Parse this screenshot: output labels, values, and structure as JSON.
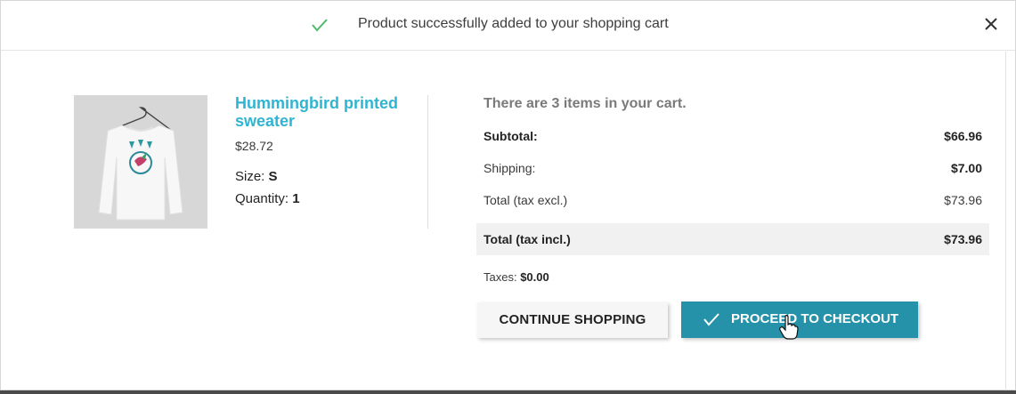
{
  "header": {
    "message": "Product successfully added to your shopping cart",
    "check_icon": "check-icon",
    "close_icon": "close-icon"
  },
  "product": {
    "image_icon": "sweater-image",
    "name": "Hummingbird printed sweater",
    "price": "$28.72",
    "size_label": "Size:",
    "size_value": "S",
    "quantity_label": "Quantity:",
    "quantity_value": "1"
  },
  "cart": {
    "count_text": "There are 3 items in your cart.",
    "subtotal_label": "Subtotal:",
    "subtotal_value": "$66.96",
    "shipping_label": "Shipping:",
    "shipping_value": "$7.00",
    "total_excl_label": "Total (tax excl.)",
    "total_excl_value": "$73.96",
    "total_incl_label": "Total (tax incl.)",
    "total_incl_value": "$73.96",
    "taxes_label": "Taxes:",
    "taxes_value": "$0.00"
  },
  "actions": {
    "continue_label": "CONTINUE SHOPPING",
    "checkout_label": "PROCEED TO CHECKOUT"
  },
  "colors": {
    "accent": "#2fb5d2",
    "checkout_button": "#2592a9",
    "success_check": "#4cbb6c"
  }
}
